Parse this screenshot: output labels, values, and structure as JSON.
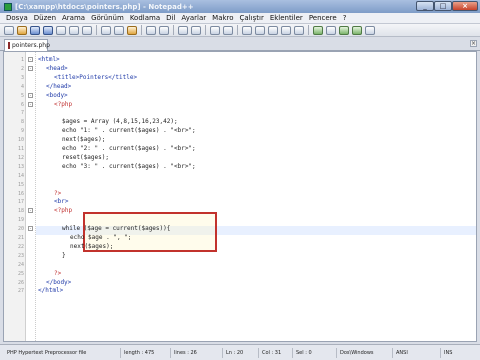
{
  "window": {
    "title": "[C:\\xampp\\htdocs\\pointers.php] - Notepad++"
  },
  "menu": [
    "Dosya",
    "Düzen",
    "Arama",
    "Görünüm",
    "Kodlama",
    "Dil",
    "Ayarlar",
    "Makro",
    "Çalıştır",
    "Eklentiler",
    "Pencere",
    "?"
  ],
  "tab": {
    "label": "pointers.php"
  },
  "editor": {
    "line_numbers": [
      "1",
      "2",
      "3",
      "4",
      "5",
      "6",
      "7",
      "8",
      "9",
      "10",
      "11",
      "12",
      "13",
      "14",
      "15",
      "16",
      "17",
      "18",
      "19",
      "20",
      "21",
      "22",
      "23",
      "24",
      "25",
      "26",
      "27"
    ],
    "lines": [
      "<html>",
      "<head>",
      "<title>Pointers</title>",
      "</head>",
      "<body>",
      "<?php",
      "",
      "$ages = Array (4,8,15,16,23,42);",
      "echo \"1: \" . current($ages) . \"<br>\";",
      "next($ages);",
      "echo \"2: \" . current($ages) . \"<br>\";",
      "reset($ages);",
      "echo \"3: \" . current($ages) . \"<br>\";",
      "",
      "",
      "?>",
      "<br>",
      "<?php",
      "",
      "while ($age = current($ages)){",
      "echo $age . \", \";",
      "next($ages);",
      "}",
      "",
      "?>",
      "</body>",
      "</html>"
    ]
  },
  "status": {
    "file_type": "PHP Hypertext Preprocessor file",
    "length": "length : 475",
    "lines": "lines : 26",
    "ln": "Ln : 20",
    "col": "Col : 31",
    "sel": "Sel : 0",
    "eol": "Dos\\Windows",
    "encoding": "ANSI",
    "mode": "INS"
  }
}
